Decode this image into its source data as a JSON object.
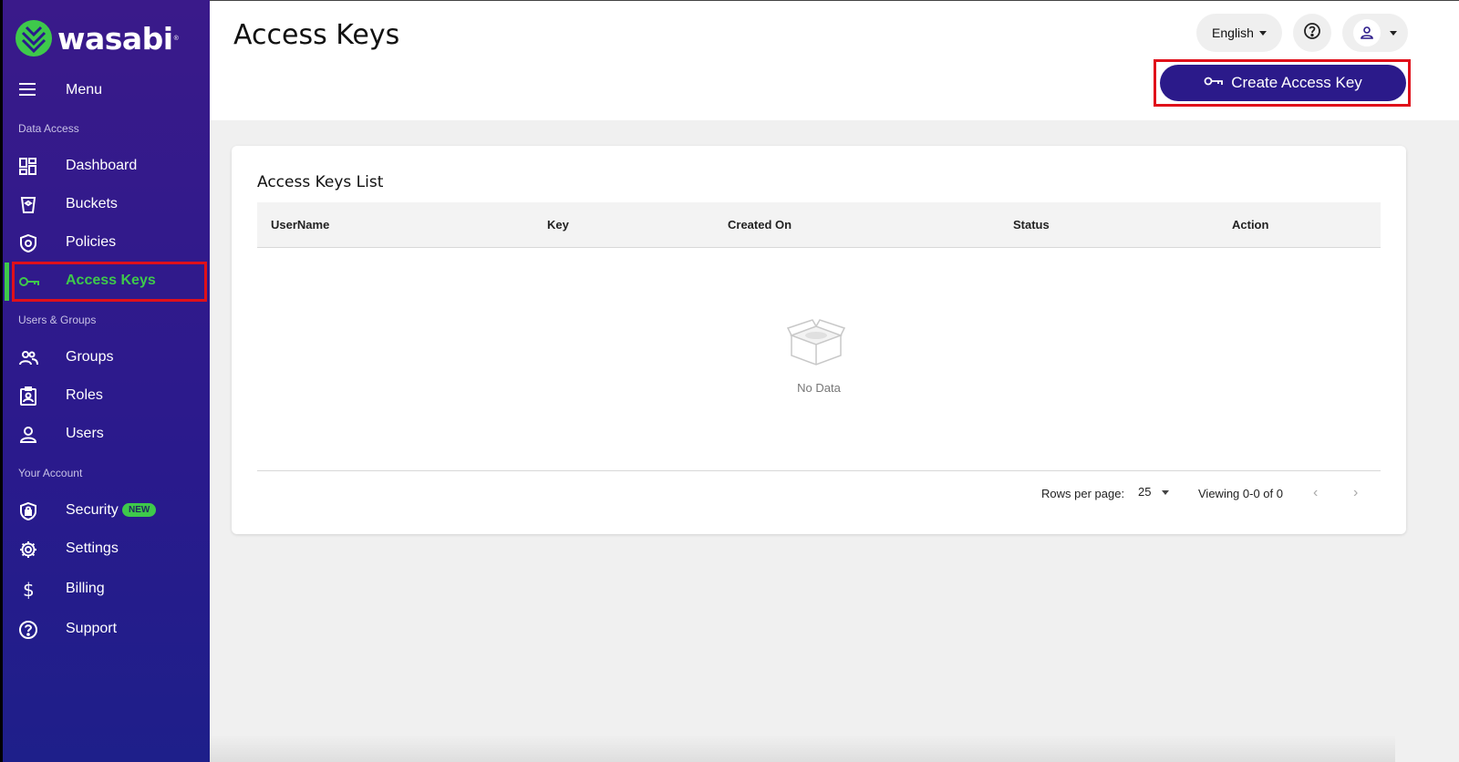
{
  "brand": {
    "name": "wasabi",
    "reg": "®",
    "accent": "#3ec94b",
    "primary": "#2b1a8a",
    "highlight": "#e0101a"
  },
  "sidebar": {
    "menu_label": "Menu",
    "sections": [
      {
        "title": "Data Access"
      },
      {
        "title": "Users & Groups"
      },
      {
        "title": "Your Account"
      }
    ],
    "items": [
      {
        "label": "Dashboard",
        "icon": "dashboard-icon"
      },
      {
        "label": "Buckets",
        "icon": "bucket-icon"
      },
      {
        "label": "Policies",
        "icon": "shield-icon"
      },
      {
        "label": "Access Keys",
        "icon": "key-icon",
        "active": true
      },
      {
        "label": "Groups",
        "icon": "groups-icon"
      },
      {
        "label": "Roles",
        "icon": "role-badge-icon"
      },
      {
        "label": "Users",
        "icon": "user-icon"
      },
      {
        "label": "Security",
        "icon": "security-shield-icon",
        "badge": "NEW"
      },
      {
        "label": "Settings",
        "icon": "gear-icon"
      },
      {
        "label": "Billing",
        "icon": "dollar-icon"
      },
      {
        "label": "Support",
        "icon": "help-circle-icon"
      }
    ]
  },
  "header": {
    "title": "Access Keys",
    "language": "English",
    "create_button": "Create Access Key"
  },
  "card": {
    "title": "Access Keys List",
    "columns": [
      "UserName",
      "Key",
      "Created On",
      "Status",
      "Action"
    ],
    "empty_text": "No Data",
    "rows_per_page_label": "Rows per page:",
    "rows_per_page_value": "25",
    "viewing": "Viewing 0-0 of 0"
  }
}
